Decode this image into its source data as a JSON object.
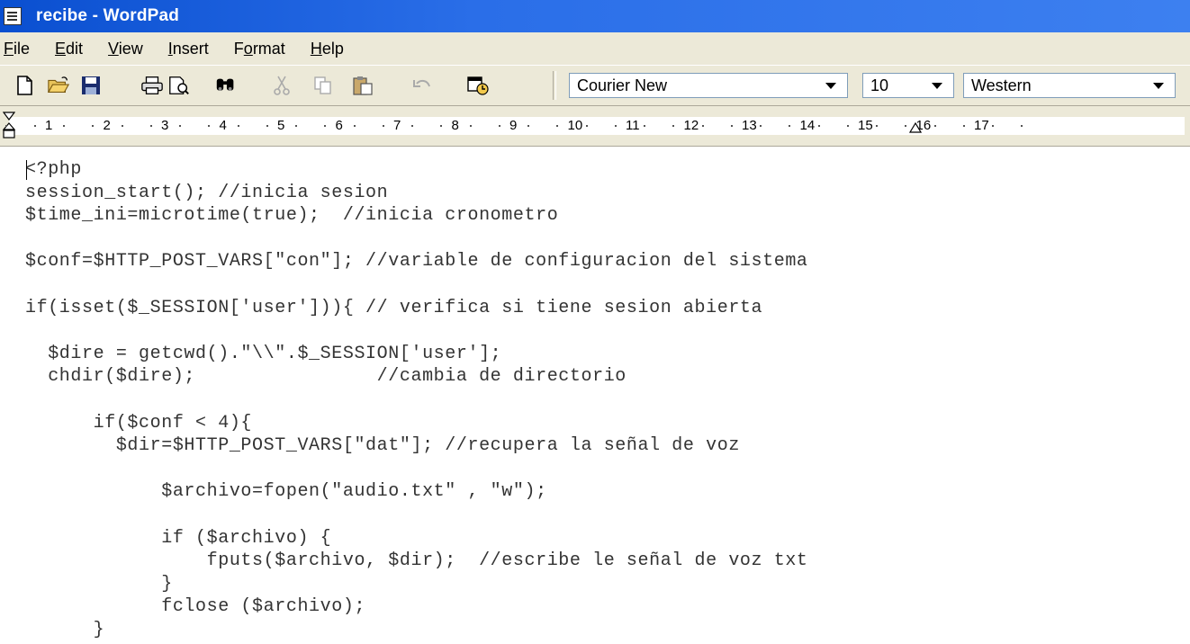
{
  "window": {
    "title": "recibe - WordPad"
  },
  "menu": [
    {
      "label": "File",
      "accel": "F",
      "rest": "ile"
    },
    {
      "label": "Edit",
      "accel": "E",
      "rest": "dit"
    },
    {
      "label": "View",
      "accel": "V",
      "rest": "iew"
    },
    {
      "label": "Insert",
      "accel": "I",
      "rest": "nsert"
    },
    {
      "label": "Format",
      "pre": "F",
      "accel": "o",
      "rest": "rmat"
    },
    {
      "label": "Help",
      "accel": "H",
      "rest": "elp"
    }
  ],
  "toolbar": {
    "icons": [
      "new-icon",
      "open-icon",
      "save-icon",
      "print-icon",
      "print-preview-icon",
      "find-icon",
      "cut-icon",
      "copy-icon",
      "paste-icon",
      "undo-icon",
      "date-time-icon"
    ],
    "font_name": "Courier New",
    "font_size": "10",
    "script": "Western"
  },
  "ruler": {
    "numbers": [
      "1",
      "2",
      "3",
      "4",
      "5",
      "6",
      "7",
      "8",
      "9",
      "10",
      "11",
      "12",
      "13",
      "14",
      "15",
      "16",
      "17"
    ]
  },
  "document": {
    "lines": [
      "<?php",
      "session_start(); //inicia sesion",
      "$time_ini=microtime(true);  //inicia cronometro",
      "",
      "$conf=$HTTP_POST_VARS[\"con\"]; //variable de configuracion del sistema",
      "",
      "if(isset($_SESSION['user'])){ // verifica si tiene sesion abierta",
      "",
      "  $dire = getcwd().\"\\\\\".$_SESSION['user'];",
      "  chdir($dire);                //cambia de directorio",
      "",
      "      if($conf < 4){",
      "        $dir=$HTTP_POST_VARS[\"dat\"]; //recupera la señal de voz",
      "",
      "            $archivo=fopen(\"audio.txt\" , \"w\");",
      "",
      "            if ($archivo) {",
      "                fputs($archivo, $dir);  //escribe le señal de voz txt",
      "            }",
      "            fclose ($archivo);",
      "      }"
    ]
  }
}
